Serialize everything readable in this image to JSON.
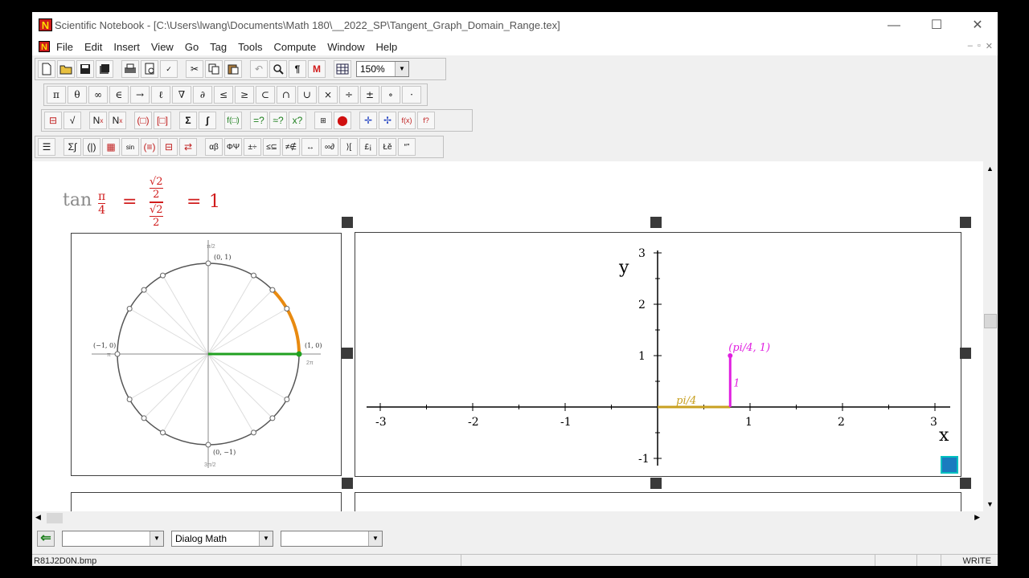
{
  "window": {
    "title": "Scientific Notebook - [C:\\Users\\lwang\\Documents\\Math 180\\__2022_SP\\Tangent_Graph_Domain_Range.tex]",
    "minimize": "—",
    "maximize": "☐",
    "close": "✕"
  },
  "menu": [
    "File",
    "Edit",
    "Insert",
    "View",
    "Go",
    "Tag",
    "Tools",
    "Compute",
    "Window",
    "Help"
  ],
  "toolbar1": {
    "zoom": "150%",
    "m_label": "M"
  },
  "toolbar2": {
    "symbols": [
      "π",
      "θ",
      "∞",
      "∈",
      "→",
      "ℓ",
      "∇",
      "∂",
      "≤",
      "≥",
      "⊂",
      "∩",
      "∪",
      "×",
      "÷",
      "±",
      "∘",
      "·"
    ]
  },
  "toolbar3": {
    "sigma": "Σ",
    "integral": "∫",
    "n_sup": "N",
    "n_sub": "N"
  },
  "equation": {
    "func": "tan",
    "arg_num": "π",
    "arg_den": "4",
    "eq1": "=",
    "sqrt_num": "√2",
    "half_den": "2",
    "eq2": "=",
    "result": "1"
  },
  "unit_circle": {
    "labels_top": "(0, 1)",
    "labels_bottom": "(0, −1)",
    "labels_right": "(1, 0)",
    "labels_left": "(−1, 0)",
    "angle_top": "π/2",
    "angle_bottom": "3π/2",
    "angle_right": "2π",
    "angle_left": "π"
  },
  "chart_data": {
    "type": "line",
    "xlabel": "x",
    "ylabel": "y",
    "xlim": [
      -3.2,
      3.2
    ],
    "ylim": [
      -1.2,
      3.2
    ],
    "xticks": [
      "-3",
      "-2",
      "-1",
      "1",
      "2",
      "3"
    ],
    "yticks": [
      "-1",
      "1",
      "2",
      "3"
    ],
    "series": [
      {
        "name": "pi/4",
        "points": [
          [
            0,
            0
          ],
          [
            0.785,
            0
          ]
        ],
        "color": "#c8a020"
      },
      {
        "name": "1",
        "points": [
          [
            0.785,
            0
          ],
          [
            0.785,
            1
          ]
        ],
        "color": "#e020e0"
      }
    ],
    "point": {
      "x": 0.785,
      "y": 1,
      "label": "(pi/4, 1)"
    }
  },
  "status": {
    "combo1": "",
    "combo2": "Dialog Math",
    "combo3": "",
    "filename": "R81J2D0N.bmp",
    "mode": "WRITE"
  }
}
